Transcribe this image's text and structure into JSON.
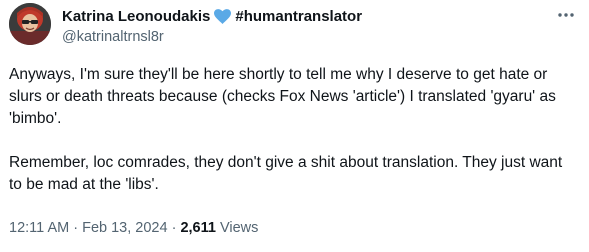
{
  "author": {
    "display_name": "Katrina Leonoudakis",
    "hashtag": "#humantranslator",
    "handle": "@katrinaltrnsl8r",
    "heart_icon": "blue-heart-icon",
    "heart_color": "#5aa9e6"
  },
  "menu": {
    "icon": "more-horizontal-icon"
  },
  "tweet": {
    "paragraphs": [
      "Anyways, I'm sure they'll be here shortly to tell me why I deserve to get hate or slurs or death threats because (checks Fox News 'article') I translated 'gyaru' as 'bimbo'.",
      "Remember, loc comrades, they don't give a shit about translation. They just want to be mad at the 'libs'."
    ]
  },
  "meta": {
    "time": "12:11 AM",
    "separator": " · ",
    "date": "Feb 13, 2024",
    "views_count": "2,611",
    "views_label": "Views"
  },
  "colors": {
    "text_primary": "#0f1419",
    "text_secondary": "#536471"
  }
}
